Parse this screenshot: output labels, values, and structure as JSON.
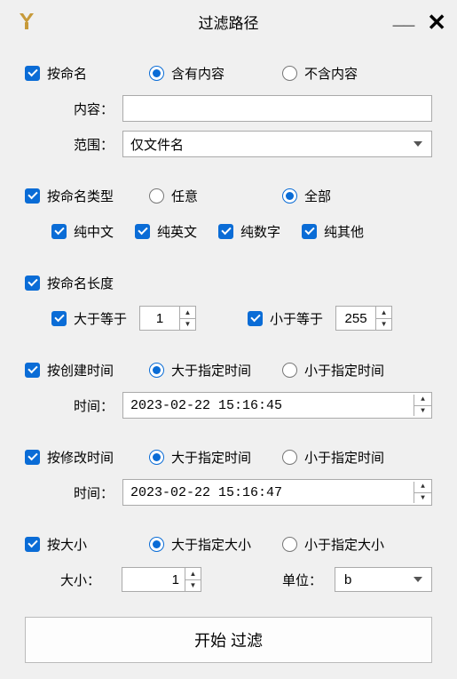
{
  "window": {
    "title": "过滤路径"
  },
  "byName": {
    "label": "按命名",
    "contains": "含有内容",
    "notContains": "不含内容",
    "contentLabel": "内容：",
    "contentValue": "",
    "scopeLabel": "范围：",
    "scopeValue": "仅文件名"
  },
  "byNameType": {
    "label": "按命名类型",
    "any": "任意",
    "all": "全部",
    "types": [
      "纯中文",
      "纯英文",
      "纯数字",
      "纯其他"
    ]
  },
  "byNameLength": {
    "label": "按命名长度",
    "gte": "大于等于",
    "gteValue": "1",
    "lte": "小于等于",
    "lteValue": "255"
  },
  "byCreateTime": {
    "label": "按创建时间",
    "gt": "大于指定时间",
    "lt": "小于指定时间",
    "timeLabel": "时间：",
    "timeValue": "2023-02-22 15:16:45"
  },
  "byModifyTime": {
    "label": "按修改时间",
    "gt": "大于指定时间",
    "lt": "小于指定时间",
    "timeLabel": "时间：",
    "timeValue": "2023-02-22 15:16:47"
  },
  "bySize": {
    "label": "按大小",
    "gt": "大于指定大小",
    "lt": "小于指定大小",
    "sizeLabel": "大小：",
    "sizeValue": "1",
    "unitLabel": "单位：",
    "unitValue": "b"
  },
  "startButton": "开始 过滤"
}
